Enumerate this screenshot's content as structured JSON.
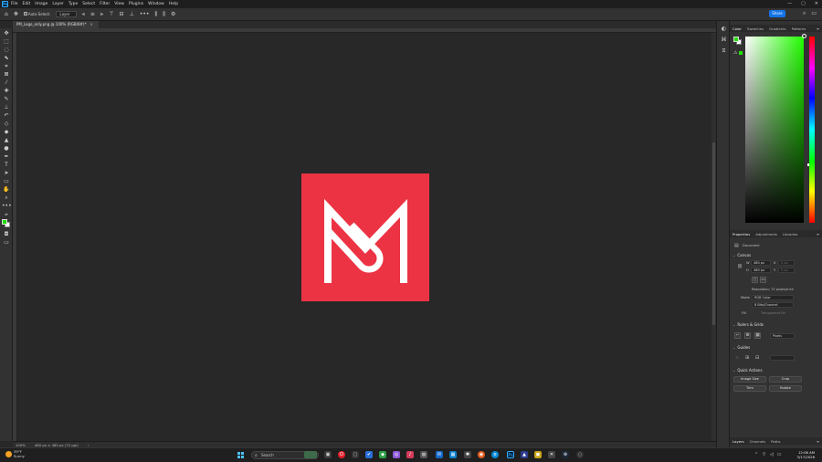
{
  "app": {
    "logo_text": "Ps"
  },
  "menus": [
    "File",
    "Edit",
    "Image",
    "Layer",
    "Type",
    "Select",
    "Filter",
    "View",
    "Plugins",
    "Window",
    "Help"
  ],
  "window_controls": {
    "minimize": "—",
    "maximize": "▢",
    "close": "✕"
  },
  "options_bar": {
    "auto_select_label": "Auto-Select:",
    "auto_select_target": "Layer",
    "more": "•••",
    "share_label": "Share"
  },
  "document_tab": {
    "title": "PM_Logo_only.png @ 100% (RGB/8#)",
    "modified": "*",
    "close": "×"
  },
  "status_bar": {
    "zoom": "100%",
    "dimensions": "480 px × 480 px (72 ppi)",
    "arrow": "›"
  },
  "toolbar": {
    "more": "•••"
  },
  "color_panel": {
    "tabs": [
      "Color",
      "Swatches",
      "Gradients",
      "Patterns"
    ],
    "active_tab": "Color",
    "foreground": "#22e000",
    "background": "#ffffff"
  },
  "properties_panel": {
    "tabs": [
      "Properties",
      "Adjustments",
      "Libraries"
    ],
    "doc_label": "Document",
    "canvas": {
      "title": "Canvas",
      "w_label": "W",
      "w_value": "480 px",
      "h_label": "H",
      "h_value": "480 px",
      "x_label": "X",
      "x_value": "0 px",
      "y_label": "Y",
      "y_value": "0 px",
      "resolution": "Resolution: 72 pixels/inch",
      "mode_label": "Mode",
      "mode_value": "RGB Color",
      "depth_value": "8 Bits/Channel",
      "fill_label": "Fill",
      "fill_value": "Transparent Fill"
    },
    "rulers": {
      "title": "Rulers & Grids",
      "unit": "Pixels"
    },
    "guides": {
      "title": "Guides"
    },
    "quick_actions": {
      "title": "Quick Actions",
      "buttons": [
        "Image Size",
        "Crop",
        "Trim",
        "Rotate"
      ]
    }
  },
  "layers_panel": {
    "tabs": [
      "Layers",
      "Channels",
      "Paths"
    ],
    "active_tab": "Layers"
  },
  "taskbar": {
    "weather_temp": "39°F",
    "weather_desc": "Sunny",
    "search_placeholder": "Search",
    "time": "12:08 AM",
    "date": "3/17/2026"
  },
  "logo_art_color": "#ec3344"
}
